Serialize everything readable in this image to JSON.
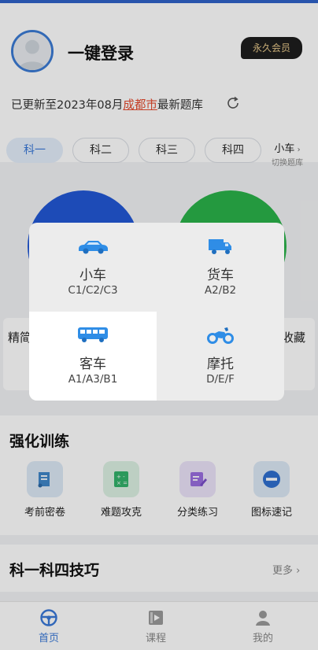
{
  "header": {
    "login_title": "一键登录",
    "vip_label": "永久会员",
    "update_prefix": "已更新至2023年08月",
    "update_city": "成都市",
    "update_suffix": "最新题库"
  },
  "subject_tabs": [
    {
      "label": "科一",
      "active": true
    },
    {
      "label": "科二",
      "active": false
    },
    {
      "label": "科三",
      "active": false
    },
    {
      "label": "科四",
      "active": false
    }
  ],
  "car_switch": {
    "current": "小车",
    "hint": "切换题库"
  },
  "middle": {
    "left_text": "精简",
    "right_text": "收藏"
  },
  "training": {
    "title": "强化训练",
    "items": [
      {
        "label": "考前密卷",
        "icon": "scroll-icon"
      },
      {
        "label": "难题攻克",
        "icon": "calculator-icon"
      },
      {
        "label": "分类练习",
        "icon": "edit-note-icon"
      },
      {
        "label": "图标速记",
        "icon": "no-entry-sign-icon"
      }
    ]
  },
  "tips": {
    "title": "科一科四技巧",
    "more": "更多"
  },
  "bottom_nav": [
    {
      "label": "首页",
      "icon": "steering-wheel-icon",
      "active": true
    },
    {
      "label": "课程",
      "icon": "video-play-icon",
      "active": false
    },
    {
      "label": "我的",
      "icon": "user-icon",
      "active": false
    }
  ],
  "vehicle_popup": {
    "options": [
      {
        "name": "小车",
        "codes": "C1/C2/C3",
        "icon": "car-icon",
        "selected": false
      },
      {
        "name": "货车",
        "codes": "A2/B2",
        "icon": "truck-icon",
        "selected": false
      },
      {
        "name": "客车",
        "codes": "A1/A3/B1",
        "icon": "bus-icon",
        "selected": true
      },
      {
        "name": "摩托",
        "codes": "D/E/F",
        "icon": "motorcycle-icon",
        "selected": false
      }
    ]
  },
  "colors": {
    "accent": "#3a79d8",
    "icon_blue": "#2f8de6",
    "city_red": "#e54a2e",
    "vip_gold": "#e8c98a",
    "circle_blue": "#2258d6",
    "circle_green": "#2bb34a"
  }
}
